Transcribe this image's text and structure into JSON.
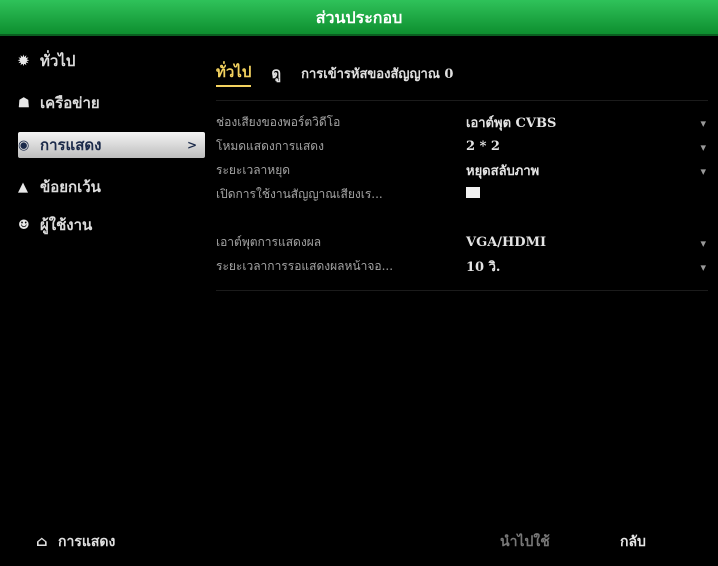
{
  "header": {
    "title": "ส่วนประกอบ"
  },
  "sidebar": {
    "items": [
      {
        "label": "ทั่วไป",
        "icon": "gear-icon"
      },
      {
        "label": "เครือข่าย",
        "icon": "network-icon"
      },
      {
        "label": "การแสดง",
        "icon": "eye-icon",
        "arrow": ">"
      },
      {
        "label": "ข้อยกเว้น",
        "icon": "warning-icon"
      },
      {
        "label": "ผู้ใช้งาน",
        "icon": "users-icon"
      }
    ]
  },
  "tabs": [
    {
      "label": "ทั่วไป"
    },
    {
      "label": "ดู"
    },
    {
      "label": "การเข้ารหัสของสัญญาณ 0"
    }
  ],
  "settings": [
    {
      "label": "ช่องเสียงของพอร์ตวิดีโอ",
      "value": "เอาต์พุต CVBS"
    },
    {
      "label": "โหมดแสดงการแสดง",
      "value": "2 * 2"
    },
    {
      "label": "ระยะเวลาหยุด",
      "value": "หยุดสลับภาพ"
    },
    {
      "label": "เปิดการใช้งานสัญญาณเสียงเร...",
      "value": ""
    },
    {
      "label": "เอาต์พุตการแสดงผล",
      "value": "VGA/HDMI"
    },
    {
      "label": "ระยะเวลาการรอแสดงผลหน้าจอ...",
      "value": "10 วิ."
    }
  ],
  "footer": {
    "home_label": "การแสดง",
    "apply_label": "นำไปใช้",
    "back_label": "กลับ"
  },
  "colors": {
    "header_green": "#1ea843",
    "active_tab": "#f3d25f"
  }
}
